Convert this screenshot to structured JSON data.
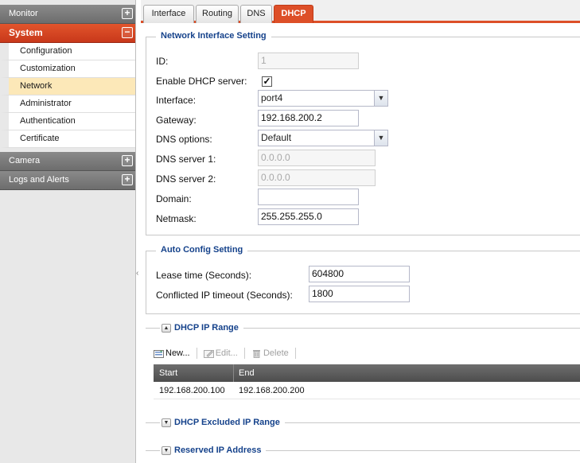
{
  "sidebar": {
    "sections": [
      {
        "label": "Monitor",
        "toggle": "+"
      },
      {
        "label": "System",
        "toggle": "−"
      },
      {
        "label": "Camera",
        "toggle": "+"
      },
      {
        "label": "Logs and Alerts",
        "toggle": "+"
      }
    ],
    "system_items": [
      {
        "label": "Configuration"
      },
      {
        "label": "Customization"
      },
      {
        "label": "Network"
      },
      {
        "label": "Administrator"
      },
      {
        "label": "Authentication"
      },
      {
        "label": "Certificate"
      }
    ],
    "selected": "Network",
    "collapse_glyph": "‹"
  },
  "tabs": [
    {
      "label": "Interface"
    },
    {
      "label": "Routing"
    },
    {
      "label": "DNS"
    },
    {
      "label": "DHCP"
    }
  ],
  "active_tab": "DHCP",
  "network_interface": {
    "title": "Network Interface Setting",
    "id_label": "ID:",
    "id_value": "1",
    "enable_label": "Enable DHCP server:",
    "enable_checked": true,
    "check_glyph": "✓",
    "interface_label": "Interface:",
    "interface_value": "port4",
    "gateway_label": "Gateway:",
    "gateway_value": "192.168.200.2",
    "dns_options_label": "DNS options:",
    "dns_options_value": "Default",
    "dns1_label": "DNS server 1:",
    "dns1_value": "0.0.0.0",
    "dns2_label": "DNS server 2:",
    "dns2_value": "0.0.0.0",
    "domain_label": "Domain:",
    "domain_value": "",
    "netmask_label": "Netmask:",
    "netmask_value": "255.255.255.0"
  },
  "auto_config": {
    "title": "Auto Config Setting",
    "lease_label": "Lease time (Seconds):",
    "lease_value": "604800",
    "conflict_label": "Conflicted IP timeout (Seconds):",
    "conflict_value": "1800"
  },
  "dhcp_range": {
    "title": "DHCP IP Range",
    "toolbar": {
      "new": "New...",
      "edit": "Edit...",
      "delete": "Delete"
    },
    "columns": [
      "Start",
      "End"
    ],
    "rows": [
      {
        "start": "192.168.200.100",
        "end": "192.168.200.200"
      }
    ]
  },
  "excluded": {
    "title": "DHCP Excluded IP Range"
  },
  "reserved": {
    "title": "Reserved IP Address"
  },
  "colors": {
    "accent": "#dd4f28",
    "legend": "#15428b",
    "selected_row": "#fce8b8"
  }
}
